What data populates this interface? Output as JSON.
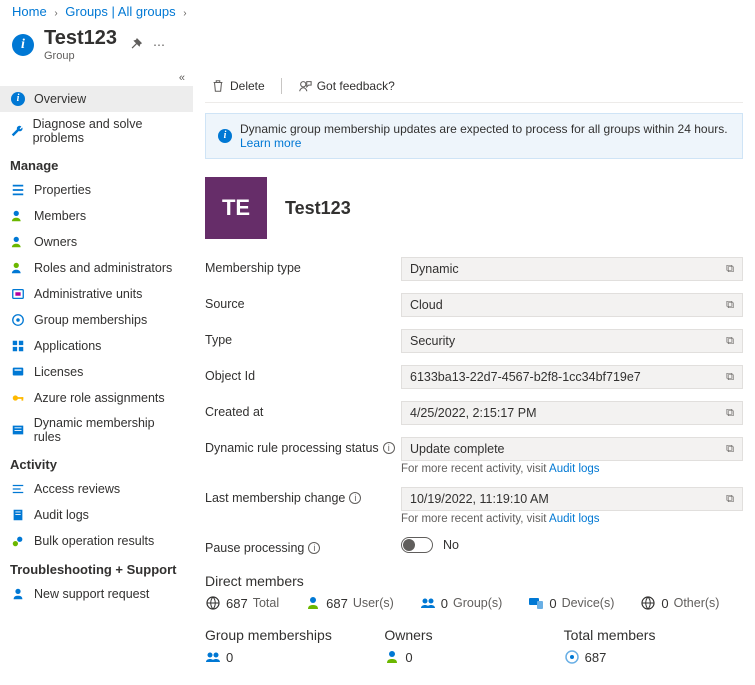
{
  "breadcrumb": {
    "home": "Home",
    "groups": "Groups | All groups"
  },
  "header": {
    "title": "Test123",
    "subtitle": "Group"
  },
  "sidebar": {
    "items_top": [
      {
        "icon": "info-icon",
        "label": "Overview",
        "selected": true
      },
      {
        "icon": "wrench-icon",
        "label": "Diagnose and solve problems"
      }
    ],
    "manage_label": "Manage",
    "items_manage": [
      {
        "icon": "properties-icon",
        "label": "Properties"
      },
      {
        "icon": "members-icon",
        "label": "Members"
      },
      {
        "icon": "owners-icon",
        "label": "Owners"
      },
      {
        "icon": "roles-icon",
        "label": "Roles and administrators"
      },
      {
        "icon": "admin-units-icon",
        "label": "Administrative units"
      },
      {
        "icon": "group-memberships-icon",
        "label": "Group memberships"
      },
      {
        "icon": "applications-icon",
        "label": "Applications"
      },
      {
        "icon": "licenses-icon",
        "label": "Licenses"
      },
      {
        "icon": "azure-roles-icon",
        "label": "Azure role assignments"
      },
      {
        "icon": "dynamic-rules-icon",
        "label": "Dynamic membership rules"
      }
    ],
    "activity_label": "Activity",
    "items_activity": [
      {
        "icon": "access-reviews-icon",
        "label": "Access reviews"
      },
      {
        "icon": "audit-logs-icon",
        "label": "Audit logs"
      },
      {
        "icon": "bulk-results-icon",
        "label": "Bulk operation results"
      }
    ],
    "ts_label": "Troubleshooting + Support",
    "items_ts": [
      {
        "icon": "support-icon",
        "label": "New support request"
      }
    ]
  },
  "toolbar": {
    "delete": "Delete",
    "feedback": "Got feedback?"
  },
  "banner": {
    "text": "Dynamic group membership updates are expected to process for all groups within 24 hours.",
    "link": "Learn more"
  },
  "group": {
    "initials": "TE",
    "name": "Test123"
  },
  "fields": {
    "membership_type": {
      "label": "Membership type",
      "value": "Dynamic"
    },
    "source": {
      "label": "Source",
      "value": "Cloud"
    },
    "type": {
      "label": "Type",
      "value": "Security"
    },
    "object_id": {
      "label": "Object Id",
      "value": "6133ba13-22d7-4567-b2f8-1cc34bf719e7"
    },
    "created_at": {
      "label": "Created at",
      "value": "4/25/2022, 2:15:17 PM"
    },
    "rule_status": {
      "label": "Dynamic rule processing status",
      "value": "Update complete",
      "helper_prefix": "For more recent activity, visit ",
      "helper_link": "Audit logs"
    },
    "last_change": {
      "label": "Last membership change",
      "value": "10/19/2022, 11:19:10 AM",
      "helper_prefix": "For more recent activity, visit ",
      "helper_link": "Audit logs"
    },
    "pause": {
      "label": "Pause processing",
      "value": "No"
    }
  },
  "direct_members": {
    "title": "Direct members",
    "total_n": "687",
    "total_l": "Total",
    "users_n": "687",
    "users_l": "User(s)",
    "groups_n": "0",
    "groups_l": "Group(s)",
    "devices_n": "0",
    "devices_l": "Device(s)",
    "others_n": "0",
    "others_l": "Other(s)"
  },
  "bottom": {
    "gm_label": "Group memberships",
    "gm_n": "0",
    "owners_label": "Owners",
    "owners_n": "0",
    "total_label": "Total members",
    "total_n": "687"
  }
}
